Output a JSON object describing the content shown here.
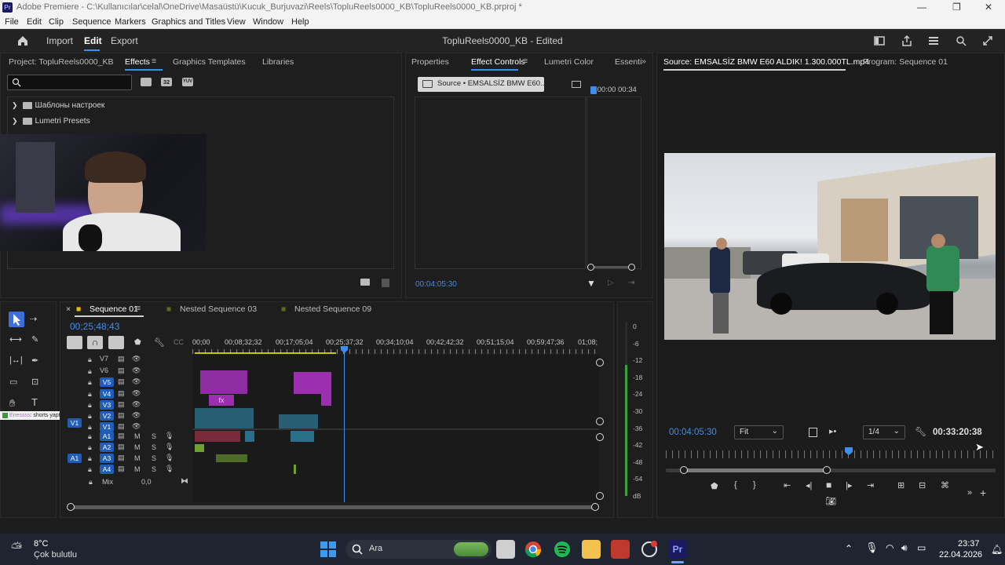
{
  "window": {
    "app_name": "Pr",
    "title": "Adobe Premiere - C:\\Kullanıcılar\\celal\\OneDrive\\Masaüstü\\Kucuk_Burjuvazi\\Reels\\TopluReels0000_KB\\TopluReels0000_KB.prproj *",
    "controls": [
      "—",
      "❐",
      "✕"
    ]
  },
  "menu": [
    "File",
    "Edit",
    "Clip",
    "Sequence",
    "Markers",
    "Graphics and Titles",
    "View",
    "Window",
    "Help"
  ],
  "header": {
    "nav": [
      "Import",
      "Edit",
      "Export"
    ],
    "center_title": "TopluReels0000_KB - Edited"
  },
  "left_panel": {
    "tabs": [
      "Project: TopluReels0000_KB",
      "Effects",
      "Graphics Templates",
      "Libraries"
    ],
    "active_tab": "Effects",
    "tree": [
      "Шаблоны настроек",
      "Lumetri Presets"
    ],
    "search_icon_labels": [
      "32",
      "YUV"
    ]
  },
  "mid_panel": {
    "tabs": [
      "Properties",
      "Effect Controls",
      "Lumetri Color",
      "Essenti"
    ],
    "active_tab": "Effect Controls",
    "source_chip": "Source • EMSALSİZ BMW E60...",
    "timecode_start": ":00:00",
    "timecode_end": "00:34",
    "current_time": "00:04:05:30"
  },
  "right_panel": {
    "tabs": [
      "Source: EMSALSİZ BMW E60 ALDIK! 1.300.000TL.mp4",
      "Program: Sequence 01"
    ],
    "current_time": "00:04:05:30",
    "fit": "Fit",
    "resolution": "1/4",
    "duration": "00:33:20:38"
  },
  "timeline": {
    "tabs": [
      "Sequence 01",
      "Nested Sequence 03",
      "Nested Sequence 09"
    ],
    "active_tab": "Sequence 01",
    "timecode": "00;25;48;43",
    "ruler": [
      "00;00",
      "00;08;32;32",
      "00;17;05;04",
      "00;25;37;32",
      "00;34;10;04",
      "00;42;42;32",
      "00;51;15;04",
      "00;59;47;36",
      "01;08;"
    ],
    "video_tracks": [
      "V7",
      "V6",
      "V5",
      "V4",
      "V3",
      "V2",
      "V1"
    ],
    "audio_tracks": [
      "A1",
      "A2",
      "A3",
      "A4"
    ],
    "mix_label": "Mix",
    "mix_value": "0,0",
    "source_patch_v": "V1",
    "source_patch_a": "A1",
    "fx_label": "fx",
    "ms_labels": [
      "M",
      "S"
    ]
  },
  "audio_meter": [
    "0",
    "-6",
    "-12",
    "-18",
    "-24",
    "-30",
    "-36",
    "-42",
    "-48",
    "-54",
    "dB"
  ],
  "overlay": {
    "user": "Enessss",
    "message": ": shorts yaptığın yeri nasıl belirliyon"
  },
  "taskbar": {
    "weather_temp": "8°C",
    "weather_desc": "Çok bulutlu",
    "search": "Ara",
    "time": "23:37",
    "date": "22.04.2026"
  },
  "colors": {
    "accent": "#3d8ef0",
    "track_badge": "#1f5db8",
    "clip_purple": "#9b2fb0",
    "clip_teal": "#2a6f8a",
    "clip_maroon": "#7a2a3a",
    "clip_green": "#6fa030"
  }
}
